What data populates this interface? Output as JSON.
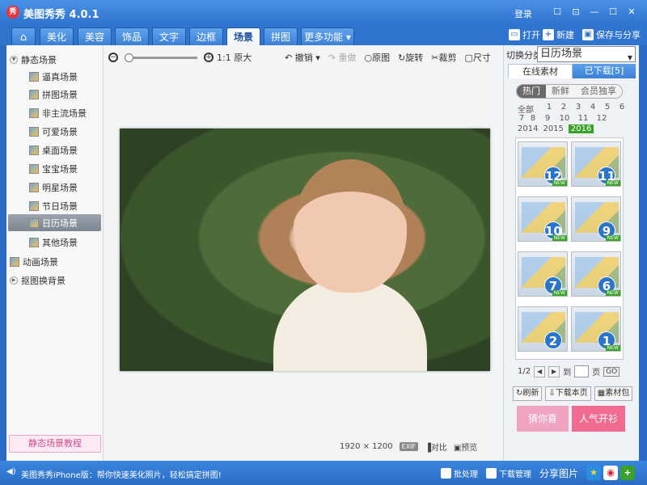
{
  "window": {
    "title": "美图秀秀 4.0.1",
    "logo_text": "秀",
    "login": "登录",
    "controls": [
      "☐",
      "⊡",
      "—",
      "☐",
      "✕"
    ]
  },
  "tabs": [
    {
      "label": "⌂",
      "name": "tab-home"
    },
    {
      "label": "美化",
      "name": "tab-beautify"
    },
    {
      "label": "美容",
      "name": "tab-beauty"
    },
    {
      "label": "饰品",
      "name": "tab-accessories"
    },
    {
      "label": "文字",
      "name": "tab-text"
    },
    {
      "label": "边框",
      "name": "tab-border"
    },
    {
      "label": "场景",
      "name": "tab-scene"
    },
    {
      "label": "拼图",
      "name": "tab-collage"
    },
    {
      "label": "更多功能 ▾",
      "name": "tab-more"
    }
  ],
  "toolbar_right": {
    "open": "打开",
    "new": "新建",
    "save_share": "保存与分享"
  },
  "sidebar": {
    "static_group": "静态场景",
    "items": [
      "逼真场景",
      "拼图场景",
      "非主流场景",
      "可爱场景",
      "桌面场景",
      "宝宝场景",
      "明星场景",
      "节日场景",
      "日历场景",
      "其他场景"
    ],
    "active_index": 8,
    "anim_group": "动画场景",
    "cutout_group": "抠图换背景",
    "tutorial": "静态场景教程"
  },
  "editor": {
    "zoom_out": "−",
    "zoom_in": "+",
    "original_size": "1:1 原大",
    "undo": "撤销",
    "redo": "重做",
    "original": "原图",
    "rotate": "旋转",
    "crop": "裁剪",
    "resize": "尺寸",
    "dimensions": "1920 × 1200",
    "exif": "EXIF",
    "compare": "对比",
    "preview": "预览"
  },
  "right_panel": {
    "switch_label": "切换分类",
    "category": "日历场景",
    "tab_online": "在线素材",
    "tab_downloaded": "已下载[5]",
    "filters": [
      "热门",
      "新鲜",
      "会员独享"
    ],
    "months": [
      "全部",
      "1",
      "2",
      "3",
      "4",
      "5",
      "6",
      "7",
      "8",
      "9",
      "10",
      "11",
      "12"
    ],
    "years": [
      "2014",
      "2015",
      "2016"
    ],
    "active_year": "2016",
    "thumbs": [
      "12",
      "11",
      "10",
      "9",
      "7",
      "6",
      "2",
      "1"
    ],
    "new_badge": "NEW",
    "pager": {
      "page": "1/2",
      "goto": "到",
      "page_unit": "页",
      "go": "GO"
    },
    "refresh": "刷新",
    "download_page": "下载本页",
    "material_pack": "素材包",
    "promo1": "猜你喜",
    "promo2": "人气开衫"
  },
  "status": {
    "message": "美图秀秀iPhone版：帮你快速美化照片，轻松搞定拼图!",
    "batch": "批处理",
    "download_mgr": "下载管理",
    "share_pic": "分享图片"
  },
  "colors": {
    "accent": "#2f74cf",
    "highlight_green": "#3aa12a",
    "thumb_badge": "#2a74c9"
  }
}
